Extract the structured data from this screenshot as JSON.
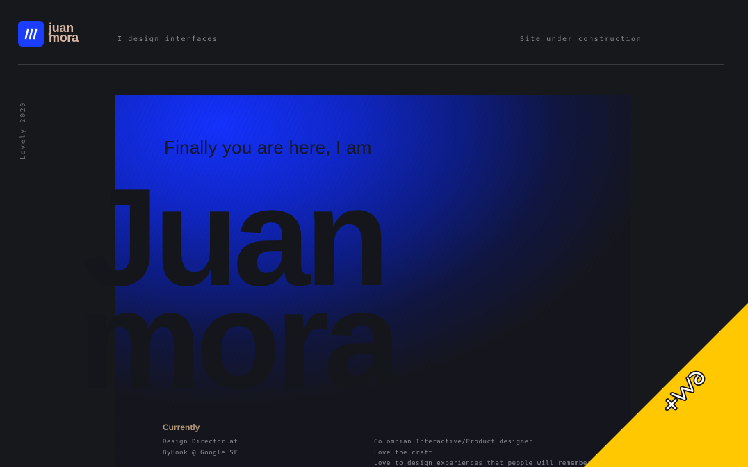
{
  "header": {
    "logo_line1": "juan",
    "logo_line2": "mora",
    "tagline": "I design interfaces",
    "status": "Site under construction"
  },
  "side": {
    "label": "Lovely 2020"
  },
  "hero": {
    "intro": "Finally you are here, I am",
    "name_line1": "Juan",
    "name_line2": "mora"
  },
  "info": {
    "title": "Currently",
    "left": [
      "Design Director at",
      "ByHook @ Google SF"
    ],
    "right": [
      "Colombian Interactive/Product designer",
      "Love the craft",
      "Love to design experiences that people will remember"
    ]
  },
  "badge": {
    "icon": "awwwards-badge-icon"
  },
  "colors": {
    "accent_blue": "#1b3dff",
    "logo_text": "#d7b7a4",
    "ribbon": "#ffc800",
    "background": "#17181c"
  }
}
